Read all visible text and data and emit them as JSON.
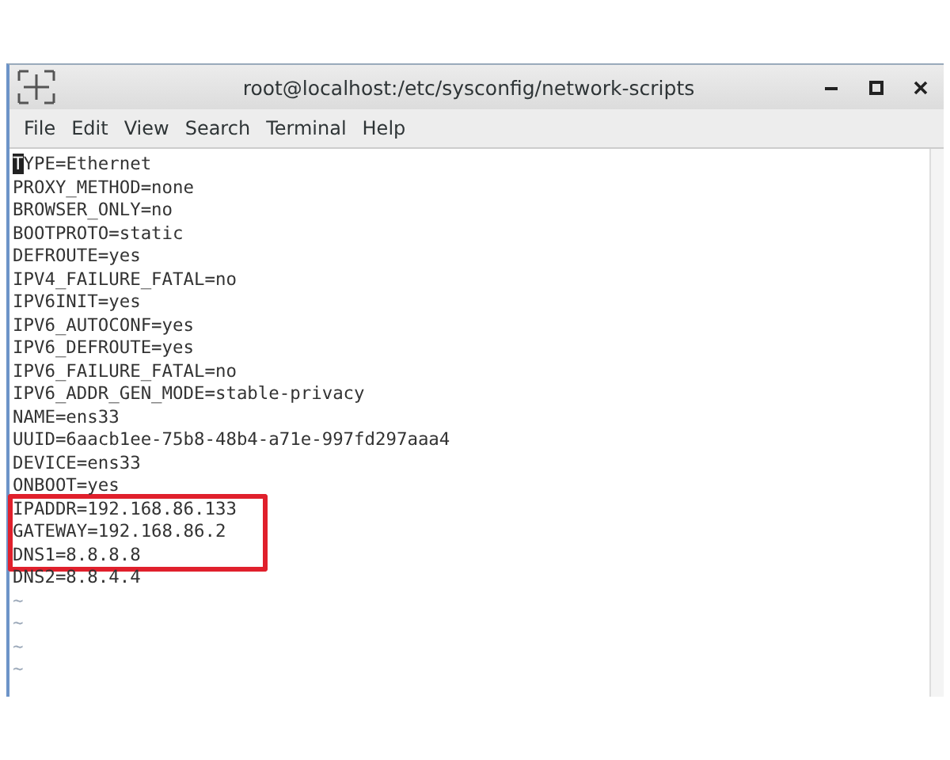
{
  "window": {
    "title": "root@localhost:/etc/sysconfig/network-scripts"
  },
  "menu": [
    "File",
    "Edit",
    "View",
    "Search",
    "Terminal",
    "Help"
  ],
  "lines": [
    {
      "text": "TYPE=Ethernet",
      "kind": "text",
      "cursor": true,
      "highlighted": false
    },
    {
      "text": "PROXY_METHOD=none",
      "kind": "text",
      "cursor": false,
      "highlighted": false
    },
    {
      "text": "BROWSER_ONLY=no",
      "kind": "text",
      "cursor": false,
      "highlighted": false
    },
    {
      "text": "BOOTPROTO=static",
      "kind": "text",
      "cursor": false,
      "highlighted": false
    },
    {
      "text": "DEFROUTE=yes",
      "kind": "text",
      "cursor": false,
      "highlighted": false
    },
    {
      "text": "IPV4_FAILURE_FATAL=no",
      "kind": "text",
      "cursor": false,
      "highlighted": false
    },
    {
      "text": "IPV6INIT=yes",
      "kind": "text",
      "cursor": false,
      "highlighted": false
    },
    {
      "text": "IPV6_AUTOCONF=yes",
      "kind": "text",
      "cursor": false,
      "highlighted": false
    },
    {
      "text": "IPV6_DEFROUTE=yes",
      "kind": "text",
      "cursor": false,
      "highlighted": false
    },
    {
      "text": "IPV6_FAILURE_FATAL=no",
      "kind": "text",
      "cursor": false,
      "highlighted": false
    },
    {
      "text": "IPV6_ADDR_GEN_MODE=stable-privacy",
      "kind": "text",
      "cursor": false,
      "highlighted": false
    },
    {
      "text": "NAME=ens33",
      "kind": "text",
      "cursor": false,
      "highlighted": false
    },
    {
      "text": "UUID=6aacb1ee-75b8-48b4-a71e-997fd297aaa4",
      "kind": "text",
      "cursor": false,
      "highlighted": false
    },
    {
      "text": "DEVICE=ens33",
      "kind": "text",
      "cursor": false,
      "highlighted": false
    },
    {
      "text": "ONBOOT=yes",
      "kind": "text",
      "cursor": false,
      "highlighted": false
    },
    {
      "text": "IPADDR=192.168.86.133",
      "kind": "text",
      "cursor": false,
      "highlighted": true
    },
    {
      "text": "GATEWAY=192.168.86.2",
      "kind": "text",
      "cursor": false,
      "highlighted": true
    },
    {
      "text": "DNS1=8.8.8.8",
      "kind": "text",
      "cursor": false,
      "highlighted": true
    },
    {
      "text": "DNS2=8.8.4.4",
      "kind": "text",
      "cursor": false,
      "highlighted": false
    },
    {
      "text": "~",
      "kind": "filler",
      "cursor": false,
      "highlighted": false
    },
    {
      "text": "~",
      "kind": "filler",
      "cursor": false,
      "highlighted": false
    },
    {
      "text": "~",
      "kind": "filler",
      "cursor": false,
      "highlighted": false
    },
    {
      "text": "~",
      "kind": "filler",
      "cursor": false,
      "highlighted": false
    }
  ]
}
